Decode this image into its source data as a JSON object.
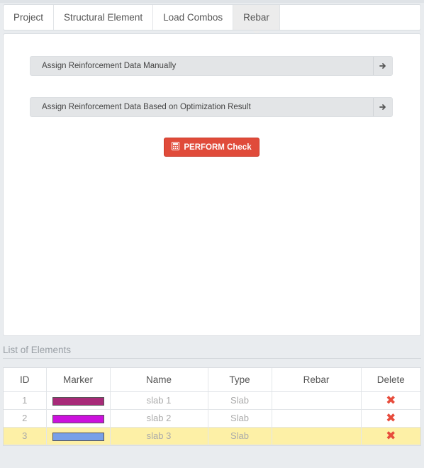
{
  "tabs": [
    {
      "label": "Project",
      "active": false
    },
    {
      "label": "Structural Element",
      "active": false
    },
    {
      "label": "Load Combos",
      "active": false
    },
    {
      "label": "Rebar",
      "active": true
    }
  ],
  "panel": {
    "manual_label": "Assign Reinforcement Data Manually",
    "optimization_label": "Assign Reinforcement Data Based on Optimization Result",
    "perform_label": "PERFORM Check",
    "perform_color": "#e04b3a"
  },
  "list": {
    "heading": "List of Elements",
    "columns": [
      "ID",
      "Marker",
      "Name",
      "Type",
      "Rebar",
      "Delete"
    ],
    "rows": [
      {
        "id": "1",
        "marker": "#a72a78",
        "name": "slab 1",
        "type": "Slab",
        "rebar": "",
        "highlight": false
      },
      {
        "id": "2",
        "marker": "#cc11dd",
        "name": "slab 2",
        "type": "Slab",
        "rebar": "",
        "highlight": false
      },
      {
        "id": "3",
        "marker": "#78a0e8",
        "name": "slab 3",
        "type": "Slab",
        "rebar": "",
        "highlight": true
      }
    ],
    "highlight_color": "#fdf0a6",
    "delete_color": "#e74c3c"
  }
}
